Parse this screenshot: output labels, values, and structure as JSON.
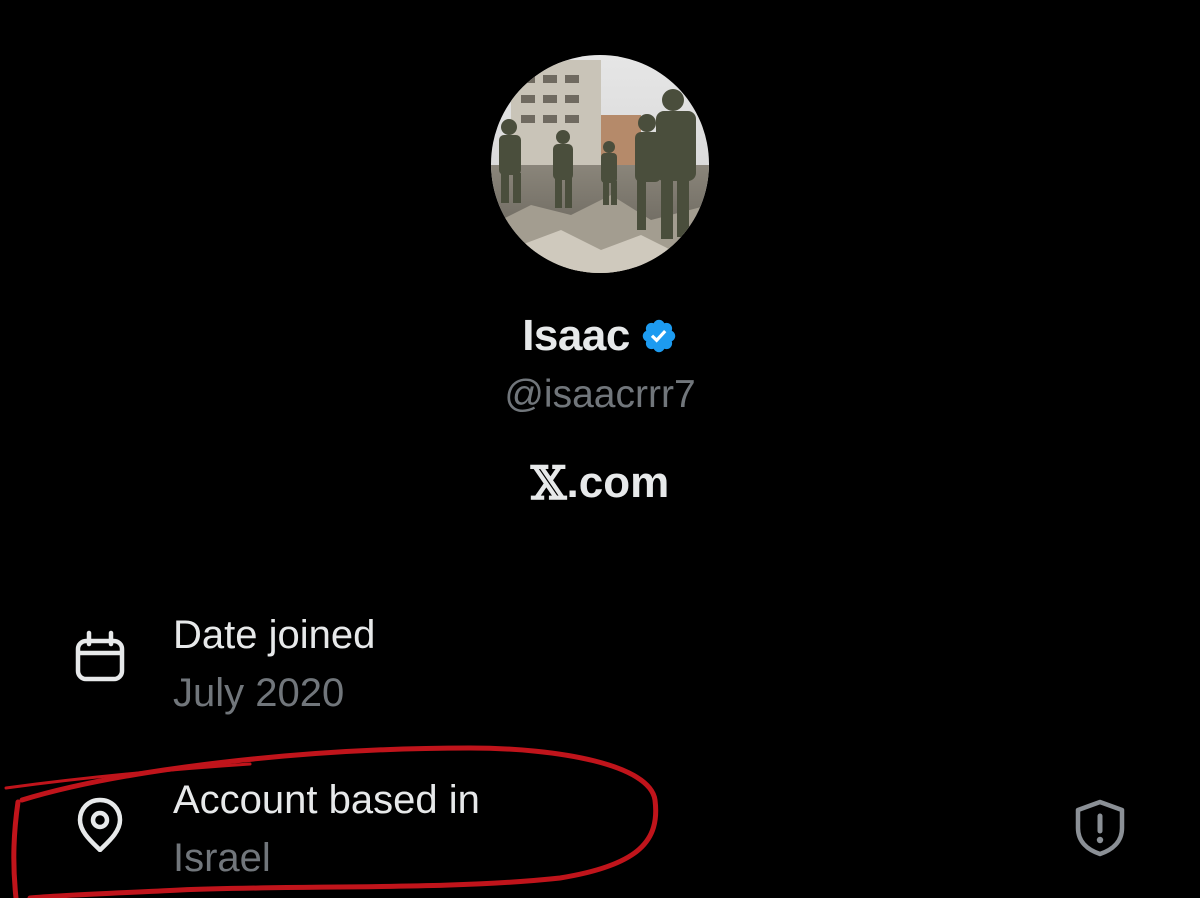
{
  "profile": {
    "display_name": "Isaac",
    "verified": true,
    "handle": "@isaacrrr7",
    "avatar_description": "avatar-photo"
  },
  "site": {
    "logo_glyph": "𝕏",
    "text": ".com"
  },
  "details": {
    "date_joined": {
      "label": "Date joined",
      "value": "July 2020",
      "icon": "calendar-icon"
    },
    "account_based_in": {
      "label": "Account based in",
      "value": "Israel",
      "icon": "location-pin-icon",
      "trailing_icon": "shield-alert-icon"
    }
  },
  "colors": {
    "background": "#000000",
    "primary_text": "#e7e9ea",
    "secondary_text": "#71767b",
    "verified_badge": "#1d9bf0",
    "annotation": "#c0141b"
  }
}
